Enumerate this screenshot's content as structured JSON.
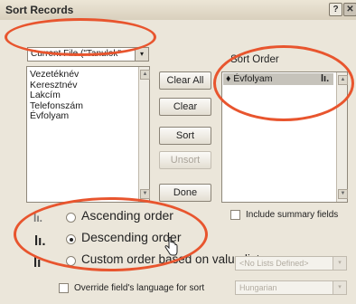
{
  "window": {
    "title": "Sort Records",
    "help_glyph": "?",
    "close_glyph": "✕"
  },
  "file_selector": {
    "value": "Current File (\"Tanulok\"",
    "arrow": "▾"
  },
  "fields": [
    "Vezetéknév",
    "Keresztnév",
    "Lakcím",
    "Telefonszám",
    "Évfolyam"
  ],
  "buttons": {
    "clear_all": "Clear All",
    "clear": "Clear",
    "sort": "Sort",
    "unsort": "Unsort",
    "done": "Done"
  },
  "sort_order": {
    "label": "Sort Order",
    "items": [
      "♦ Évfolyam"
    ],
    "item_icon": "lı."
  },
  "order_options": {
    "ascending": "Ascending order",
    "descending": "Descending order",
    "custom": "Custom order based on value list",
    "selected": "descending"
  },
  "include_summary": "Include summary fields",
  "value_list": {
    "value": "<No Lists Defined>",
    "arrow": "▾"
  },
  "override_language": "Override field's language for sort",
  "language": {
    "value": "Hungarian",
    "arrow": "▾"
  },
  "icons": {
    "asc": "lı.",
    "desc": "lı.",
    "custom": "lı"
  },
  "accent_color": "#e8552e"
}
